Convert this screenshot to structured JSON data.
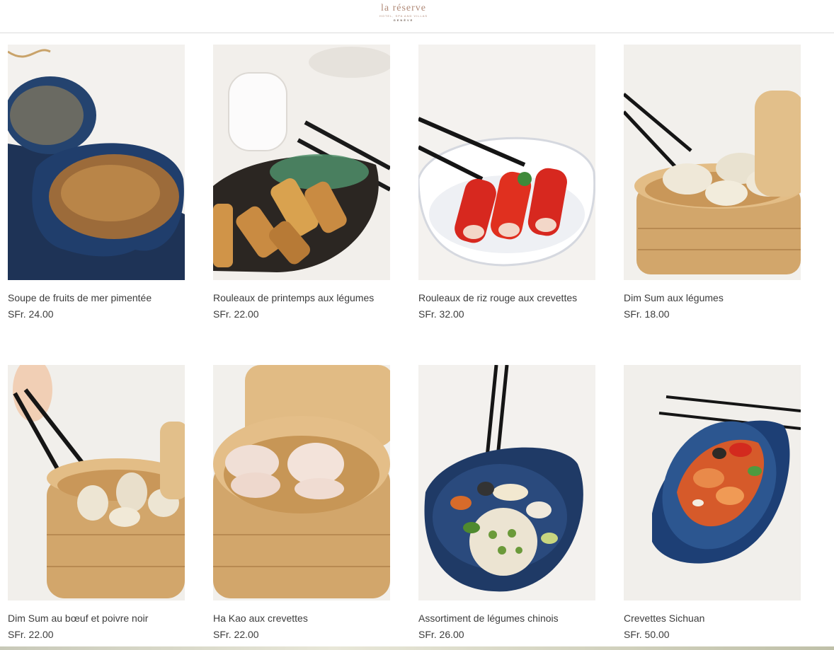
{
  "brand": {
    "name": "la réserve",
    "tagline": "HOTEL, SPA AND VILLAS",
    "city": "GENÈVE"
  },
  "currency": "SFr.",
  "items": [
    {
      "name": "Soupe de fruits de mer pimentée",
      "price": "SFr. 24.00",
      "photo_icon": "seafood-soup-photo"
    },
    {
      "name": "Rouleaux de printemps aux légumes",
      "price": "SFr. 22.00",
      "photo_icon": "spring-rolls-photo"
    },
    {
      "name": "Rouleaux de riz rouge aux crevettes",
      "price": "SFr. 32.00",
      "photo_icon": "red-rice-rolls-photo"
    },
    {
      "name": "Dim Sum aux légumes",
      "price": "SFr. 18.00",
      "photo_icon": "vegetable-dimsum-photo"
    },
    {
      "name": "Dim Sum au bœuf et poivre noir",
      "price": "SFr. 22.00",
      "photo_icon": "beef-dimsum-photo"
    },
    {
      "name": "Ha Kao aux crevettes",
      "price": "SFr. 22.00",
      "photo_icon": "ha-kao-photo"
    },
    {
      "name": "Assortiment de légumes chinois",
      "price": "SFr. 26.00",
      "photo_icon": "chinese-vegetables-photo"
    },
    {
      "name": "Crevettes Sichuan",
      "price": "SFr. 50.00",
      "photo_icon": "sichuan-shrimp-photo"
    }
  ],
  "colors": {
    "text": "#3c3c3c",
    "logo": "#b08a78",
    "divider": "#dcdcdc",
    "steamer_bamboo": "#d7b07a",
    "bowl_blue": "#1f3a66"
  }
}
